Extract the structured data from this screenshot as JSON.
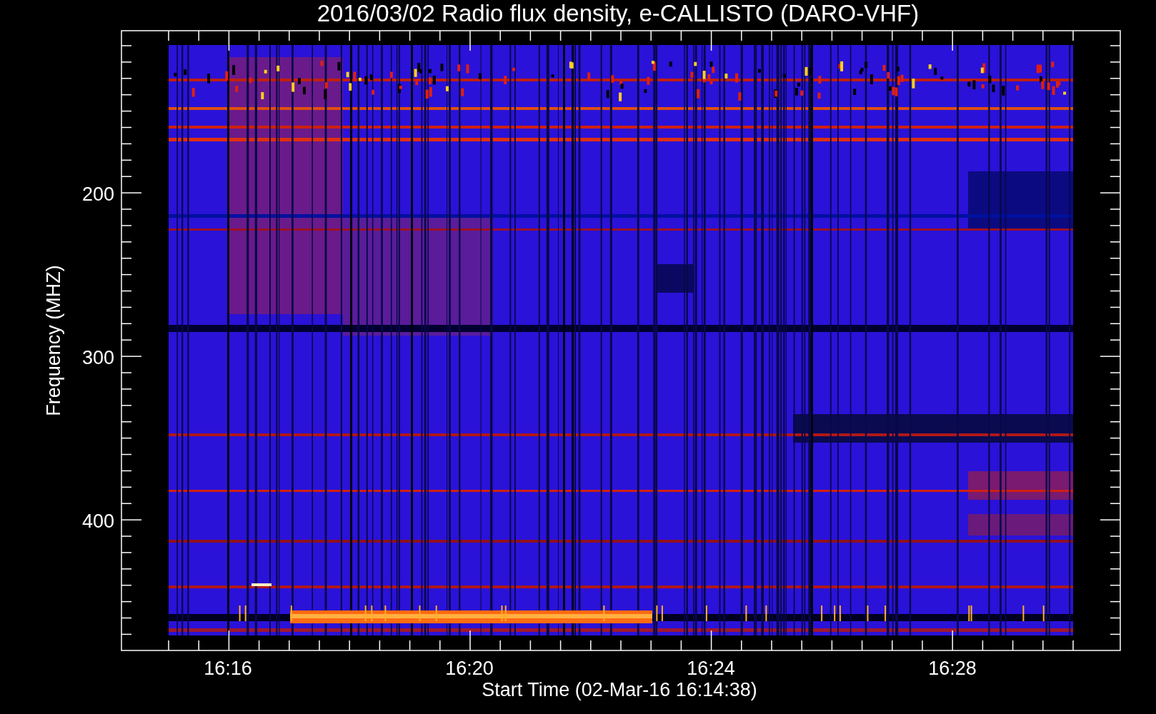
{
  "title": "2016/03/02  Radio flux density, e-CALLISTO (DARO-VHF)",
  "ylabel": "Frequency (MHZ)",
  "xlabel": "Start Time (02-Mar-16 16:14:38)",
  "yticks": [
    "200",
    "300",
    "400"
  ],
  "xticks": [
    "16:16",
    "16:20",
    "16:24",
    "16:28"
  ]
}
